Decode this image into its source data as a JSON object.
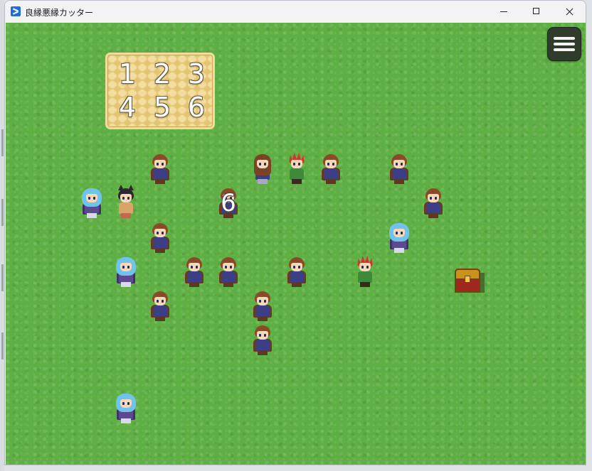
{
  "window": {
    "title": "良縁悪縁カッター",
    "icon": "app-icon",
    "controls": [
      "minimize-icon",
      "maximize-icon",
      "close-icon"
    ]
  },
  "hud": {
    "menu_icon": "hamburger-menu-icon",
    "number_panel": {
      "rows": [
        [
          "1",
          "2",
          "3"
        ],
        [
          "4",
          "5",
          "6"
        ]
      ]
    }
  },
  "characters": [
    {
      "type": "hero",
      "col": 0,
      "row": 0
    },
    {
      "type": "girl",
      "col": 1,
      "row": 0
    },
    {
      "type": "fighter",
      "col": 2,
      "row": 0
    },
    {
      "type": "hero",
      "col": 3,
      "row": 0
    },
    {
      "type": "hero",
      "col": 4,
      "row": 0
    },
    {
      "type": "mage",
      "col": 5,
      "row": 1
    },
    {
      "type": "catgirl",
      "col": 6,
      "row": 1
    },
    {
      "type": "hero",
      "col": 7,
      "row": 1,
      "label": "6"
    },
    {
      "type": "hero",
      "col": 8,
      "row": 1
    },
    {
      "type": "hero",
      "col": 9,
      "row": 2
    },
    {
      "type": "mage",
      "col": 10,
      "row": 2
    },
    {
      "type": "mage",
      "col": 11,
      "row": 3
    },
    {
      "type": "hero",
      "col": 12,
      "row": 3
    },
    {
      "type": "hero",
      "col": 13,
      "row": 3
    },
    {
      "type": "hero",
      "col": 14,
      "row": 3
    },
    {
      "type": "fighter",
      "col": 15,
      "row": 3
    },
    {
      "type": "hero",
      "col": 16,
      "row": 4
    },
    {
      "type": "hero",
      "col": 17,
      "row": 4
    },
    {
      "type": "hero",
      "col": 18,
      "row": 5
    },
    {
      "type": "mage",
      "col": 19,
      "row": 7
    }
  ],
  "objects": [
    {
      "type": "treasure-chest",
      "icon": "treasure-chest-icon"
    }
  ]
}
